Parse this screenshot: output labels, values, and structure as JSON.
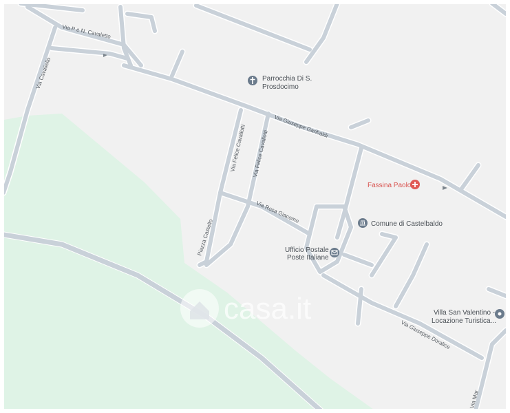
{
  "map": {
    "colors": {
      "background": "#f1f1f1",
      "park": "#dff3e6",
      "road": "#c9d1d9",
      "road_edge": "#ffffff",
      "poi_icon": "#6b7b8c",
      "poi_red": "#e05a55",
      "label": "#555b61"
    },
    "streets": [
      {
        "name": "Via P e N. Cavaletto"
      },
      {
        "name": "Via Cavaliello"
      },
      {
        "name": "Via Giuseppe Garibaldi"
      },
      {
        "name": "Via Felice Cavallotti"
      },
      {
        "name": "Via Felice Cavallotti"
      },
      {
        "name": "Via Rosa Giacomo"
      },
      {
        "name": "Piazza Castello"
      },
      {
        "name": "Via Giuseppe Doralice"
      },
      {
        "name": "Via Mar"
      }
    ],
    "pois": [
      {
        "name": "Parrocchia Di S.",
        "name2": "Prosdocimo",
        "icon": "church-icon"
      },
      {
        "name": "Fassina Paolo",
        "icon": "pharmacy-icon"
      },
      {
        "name": "Comune di Castelbaldo",
        "icon": "town-hall-icon"
      },
      {
        "name": "Ufficio Postale",
        "name2": "Poste Italiane",
        "icon": "post-office-icon"
      },
      {
        "name": "Villa San Valentino -",
        "name2": "Locazione Turistica...",
        "icon": "place-icon"
      }
    ],
    "watermark": "casa.it"
  }
}
